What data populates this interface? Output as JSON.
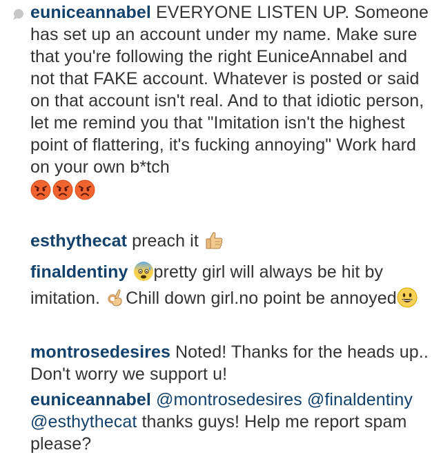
{
  "colors": {
    "username": "#12426b",
    "text": "#333333",
    "background": "#ffffff"
  },
  "caption": {
    "icon": "comment-bubble-icon",
    "username": "euniceannabel",
    "text": "EVERYONE LISTEN UP. Someone has set up an account under my name. Make sure that you're following the right EuniceAnnabel and not that FAKE account. Whatever is posted or said on that account isn't real. And to that idiotic person, let me remind you that \"Imitation isn't the highest point of flattering, it's fucking annoying\" Work hard on your own b*tch",
    "emojis": [
      "angry-face-icon",
      "angry-face-icon",
      "angry-face-icon"
    ]
  },
  "comments": [
    {
      "username": "esthythecat",
      "text": "preach it",
      "emoji": "thumbs-up-icon"
    },
    {
      "username": "finaldentiny",
      "text_1": "pretty girl will always be hit by imitation.",
      "text_2": "Chill down girl.no point be annoyed",
      "emojis": [
        "fearful-face-icon",
        "ok-hand-icon",
        "grinning-face-icon"
      ]
    },
    {
      "username": "montrosedesires",
      "text": "Noted! Thanks for the heads up.. Don't worry we support u!"
    },
    {
      "username": "euniceannabel",
      "mentions": [
        "@montrosedesires",
        "@finaldentiny",
        "@esthythecat"
      ],
      "text": "thanks guys! Help me report spam please?"
    }
  ]
}
